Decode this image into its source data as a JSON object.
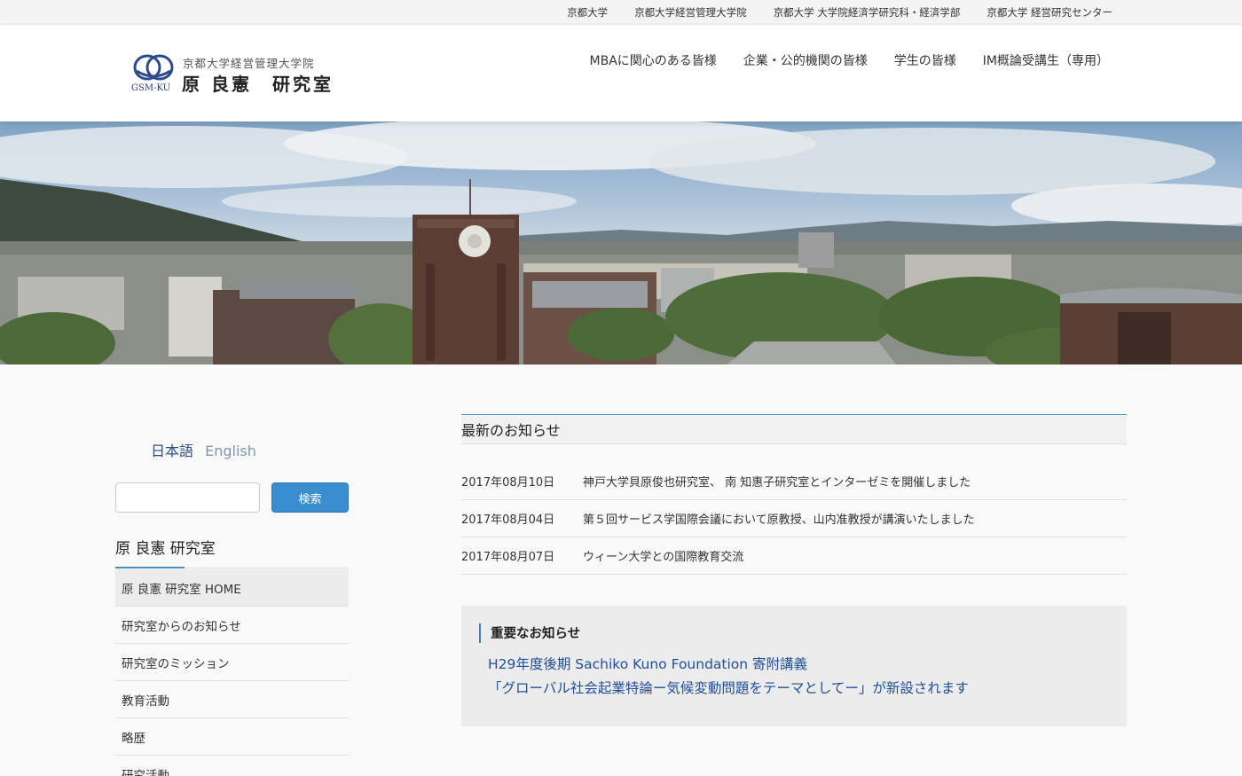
{
  "topbar": {
    "links": [
      "京都大学",
      "京都大学経営管理大学院",
      "京都大学 大学院経済学研究科・経済学部",
      "京都大学 経営研究センター"
    ]
  },
  "header": {
    "logo_mark_text": "GSM-KU",
    "logo_sub": "京都大学経営管理大学院",
    "logo_name": "原 良憲　研究室",
    "nav": [
      "MBAに関心のある皆様",
      "企業・公的機関の皆様",
      "学生の皆様",
      "IM概論受講生（専用）"
    ]
  },
  "sidebar": {
    "lang_ja": "日本語",
    "lang_en": "English",
    "search_placeholder": "",
    "search_button": "検索",
    "title": "原 良憲 研究室",
    "menu": [
      "原 良憲 研究室 HOME",
      "研究室からのお知らせ",
      "研究室のミッション",
      "教育活動",
      "略歴",
      "研究活動"
    ]
  },
  "main": {
    "news_heading": "最新のお知らせ",
    "news": [
      {
        "date": "2017年08月10日",
        "title": "神戸大学貝原俊也研究室、 南 知惠子研究室とインターゼミを開催しました"
      },
      {
        "date": "2017年08月04日",
        "title": "第５回サービス学国際会議において原教授、山内准教授が講演いたしました"
      },
      {
        "date": "2017年08月07日",
        "title": "ウィーン大学との国際教育交流"
      }
    ],
    "important_label": "重要なお知らせ",
    "important_line1": "H29年度後期 Sachiko Kuno Foundation 寄附講義",
    "important_line2": "「グローバル社会起業特論ー気候変動問題をテーマとしてー」が新設されます"
  },
  "colors": {
    "accent": "#3a8ed0",
    "link": "#1f4f9a",
    "header_bg": "#ffffff",
    "page_bg": "#f9f9f9"
  },
  "hero_image": "campus-panorama-with-clock-tower"
}
